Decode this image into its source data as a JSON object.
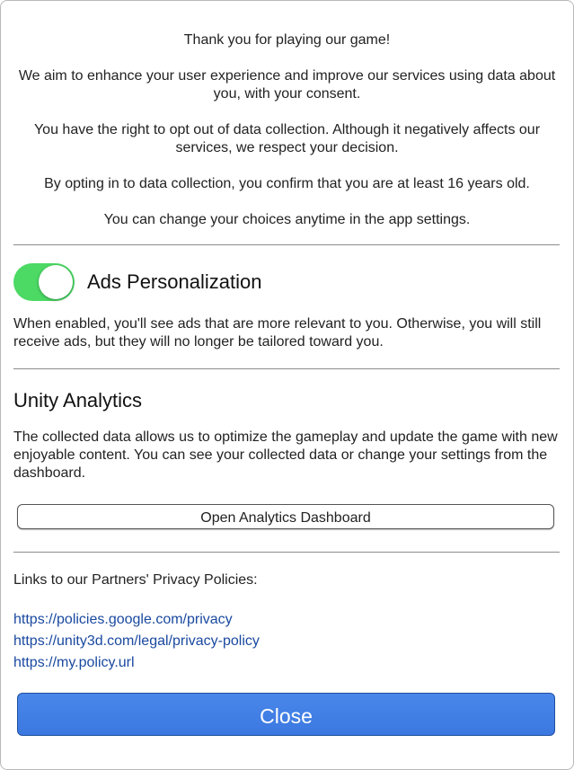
{
  "intro": {
    "thanks": "Thank you for playing our game!",
    "aim": "We aim to enhance your user experience and improve our services using data about you, with your consent.",
    "opt_out": "You have the right to opt out of data collection. Although it negatively affects our services, we respect your decision.",
    "age": "By opting in to data collection, you confirm that you are at least 16 years old.",
    "change": "You can change your choices anytime in the app settings."
  },
  "ads": {
    "title": "Ads Personalization",
    "enabled": true,
    "description": "When enabled, you'll see ads that are more relevant to you. Otherwise, you will still receive ads, but they will no longer be tailored toward you."
  },
  "analytics": {
    "title": "Unity Analytics",
    "description": "The collected data allows us to optimize the gameplay and update the game with new enjoyable content. You can see your collected data or change your settings from the dashboard.",
    "dashboard_button": "Open Analytics Dashboard"
  },
  "partners": {
    "heading": "Links to our Partners' Privacy Policies:",
    "links": [
      "https://policies.google.com/privacy",
      "https://unity3d.com/legal/privacy-policy",
      "https://my.policy.url"
    ]
  },
  "close_button": "Close",
  "colors": {
    "toggle_on": "#4cd964",
    "link": "#1a49a0",
    "primary_button": "#3b78e0"
  },
  "icons": {
    "toggle": "switch-toggle"
  }
}
